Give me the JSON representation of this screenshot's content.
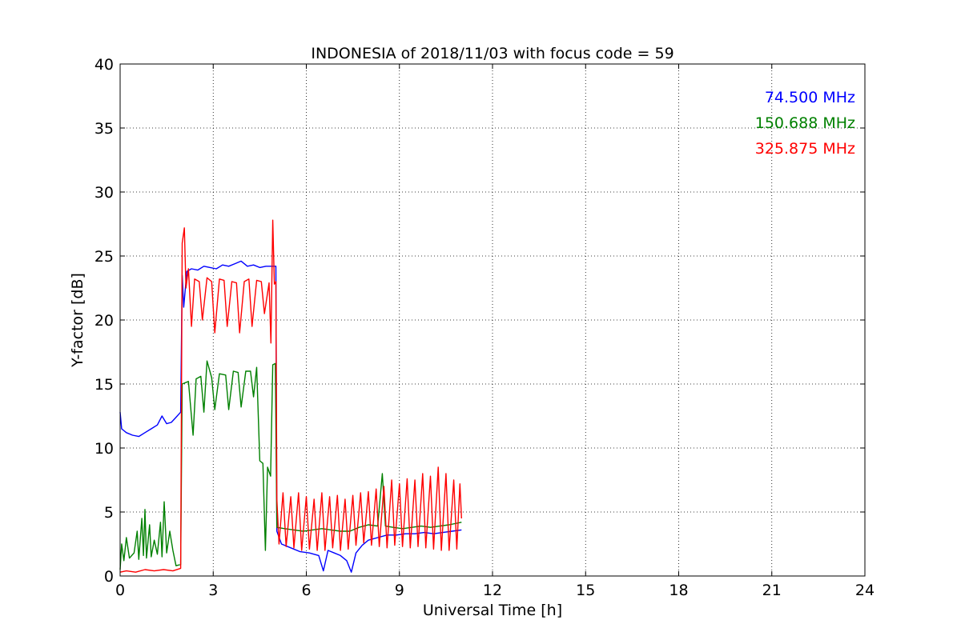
{
  "chart_data": {
    "type": "line",
    "title": "INDONESIA of 2018/11/03 with focus code = 59",
    "xlabel": "Universal Time [h]",
    "ylabel": "Y-factor [dB]",
    "xlim": [
      0,
      24
    ],
    "ylim": [
      0,
      40
    ],
    "xticks": [
      0,
      3,
      6,
      9,
      12,
      15,
      18,
      21,
      24
    ],
    "yticks": [
      0,
      5,
      10,
      15,
      20,
      25,
      30,
      35,
      40
    ],
    "grid": true,
    "legend_position": "top-right",
    "series": [
      {
        "name": "74.500 MHz",
        "color": "#0000ff",
        "points": [
          [
            0.0,
            12.8
          ],
          [
            0.05,
            11.5
          ],
          [
            0.2,
            11.2
          ],
          [
            0.4,
            11.0
          ],
          [
            0.6,
            10.9
          ],
          [
            0.8,
            11.2
          ],
          [
            1.0,
            11.5
          ],
          [
            1.2,
            11.8
          ],
          [
            1.35,
            12.5
          ],
          [
            1.5,
            11.9
          ],
          [
            1.65,
            12.0
          ],
          [
            1.8,
            12.4
          ],
          [
            1.95,
            12.8
          ],
          [
            2.0,
            23.5
          ],
          [
            2.05,
            21.0
          ],
          [
            2.15,
            23.8
          ],
          [
            2.3,
            24.0
          ],
          [
            2.5,
            23.9
          ],
          [
            2.7,
            24.2
          ],
          [
            2.9,
            24.1
          ],
          [
            3.1,
            24.0
          ],
          [
            3.3,
            24.3
          ],
          [
            3.5,
            24.2
          ],
          [
            3.7,
            24.4
          ],
          [
            3.9,
            24.6
          ],
          [
            4.1,
            24.2
          ],
          [
            4.3,
            24.3
          ],
          [
            4.5,
            24.1
          ],
          [
            4.7,
            24.2
          ],
          [
            4.9,
            24.2
          ],
          [
            5.02,
            24.2
          ],
          [
            5.05,
            3.5
          ],
          [
            5.2,
            2.5
          ],
          [
            5.5,
            2.2
          ],
          [
            5.8,
            1.9
          ],
          [
            6.1,
            1.8
          ],
          [
            6.4,
            1.6
          ],
          [
            6.55,
            0.4
          ],
          [
            6.7,
            2.0
          ],
          [
            6.9,
            1.8
          ],
          [
            7.1,
            1.6
          ],
          [
            7.3,
            1.2
          ],
          [
            7.45,
            0.3
          ],
          [
            7.6,
            1.8
          ],
          [
            7.8,
            2.4
          ],
          [
            8.0,
            2.8
          ],
          [
            8.3,
            3.0
          ],
          [
            8.6,
            3.2
          ],
          [
            8.9,
            3.2
          ],
          [
            9.2,
            3.3
          ],
          [
            9.5,
            3.3
          ],
          [
            9.8,
            3.4
          ],
          [
            10.1,
            3.3
          ],
          [
            10.4,
            3.4
          ],
          [
            10.7,
            3.5
          ],
          [
            11.0,
            3.6
          ]
        ]
      },
      {
        "name": "150.688 MHz",
        "color": "#008000",
        "points": [
          [
            0.0,
            0.5
          ],
          [
            0.05,
            2.5
          ],
          [
            0.12,
            1.2
          ],
          [
            0.2,
            3.0
          ],
          [
            0.3,
            1.4
          ],
          [
            0.45,
            1.8
          ],
          [
            0.55,
            3.5
          ],
          [
            0.6,
            1.3
          ],
          [
            0.7,
            4.5
          ],
          [
            0.75,
            1.6
          ],
          [
            0.8,
            5.2
          ],
          [
            0.85,
            1.4
          ],
          [
            0.95,
            4.0
          ],
          [
            1.0,
            1.5
          ],
          [
            1.1,
            2.8
          ],
          [
            1.2,
            1.7
          ],
          [
            1.3,
            4.2
          ],
          [
            1.35,
            1.5
          ],
          [
            1.42,
            5.8
          ],
          [
            1.5,
            1.8
          ],
          [
            1.6,
            3.5
          ],
          [
            1.7,
            2.0
          ],
          [
            1.8,
            0.8
          ],
          [
            1.95,
            0.9
          ],
          [
            2.0,
            15.0
          ],
          [
            2.2,
            15.2
          ],
          [
            2.35,
            11.0
          ],
          [
            2.45,
            15.4
          ],
          [
            2.6,
            15.6
          ],
          [
            2.7,
            12.8
          ],
          [
            2.8,
            16.8
          ],
          [
            2.95,
            15.5
          ],
          [
            3.05,
            13.0
          ],
          [
            3.2,
            15.8
          ],
          [
            3.4,
            15.7
          ],
          [
            3.5,
            13.0
          ],
          [
            3.65,
            16.0
          ],
          [
            3.8,
            15.9
          ],
          [
            3.9,
            13.2
          ],
          [
            4.05,
            16.0
          ],
          [
            4.2,
            16.0
          ],
          [
            4.3,
            14.0
          ],
          [
            4.4,
            16.3
          ],
          [
            4.5,
            9.0
          ],
          [
            4.6,
            8.8
          ],
          [
            4.68,
            2.0
          ],
          [
            4.75,
            8.5
          ],
          [
            4.85,
            7.8
          ],
          [
            4.92,
            16.5
          ],
          [
            5.0,
            16.6
          ],
          [
            5.05,
            3.8
          ],
          [
            5.3,
            3.7
          ],
          [
            5.6,
            3.6
          ],
          [
            5.9,
            3.5
          ],
          [
            6.2,
            3.6
          ],
          [
            6.5,
            3.7
          ],
          [
            6.8,
            3.6
          ],
          [
            7.1,
            3.5
          ],
          [
            7.4,
            3.5
          ],
          [
            7.7,
            3.8
          ],
          [
            8.0,
            4.0
          ],
          [
            8.3,
            3.9
          ],
          [
            8.45,
            8.0
          ],
          [
            8.55,
            3.9
          ],
          [
            8.8,
            3.8
          ],
          [
            9.1,
            3.7
          ],
          [
            9.4,
            3.8
          ],
          [
            9.7,
            3.9
          ],
          [
            10.0,
            3.8
          ],
          [
            10.3,
            3.9
          ],
          [
            10.6,
            4.0
          ],
          [
            11.0,
            4.2
          ]
        ]
      },
      {
        "name": "325.875 MHz",
        "color": "#ff0000",
        "points": [
          [
            0.0,
            0.3
          ],
          [
            0.2,
            0.4
          ],
          [
            0.5,
            0.3
          ],
          [
            0.8,
            0.5
          ],
          [
            1.1,
            0.4
          ],
          [
            1.4,
            0.5
          ],
          [
            1.7,
            0.4
          ],
          [
            1.95,
            0.6
          ],
          [
            2.0,
            26.0
          ],
          [
            2.07,
            27.2
          ],
          [
            2.12,
            22.5
          ],
          [
            2.2,
            24.0
          ],
          [
            2.3,
            19.5
          ],
          [
            2.4,
            23.2
          ],
          [
            2.55,
            23.0
          ],
          [
            2.65,
            20.0
          ],
          [
            2.8,
            23.3
          ],
          [
            2.95,
            23.0
          ],
          [
            3.05,
            19.0
          ],
          [
            3.2,
            23.2
          ],
          [
            3.35,
            23.1
          ],
          [
            3.45,
            19.5
          ],
          [
            3.6,
            23.0
          ],
          [
            3.75,
            22.9
          ],
          [
            3.85,
            19.0
          ],
          [
            4.0,
            23.0
          ],
          [
            4.15,
            23.2
          ],
          [
            4.25,
            19.5
          ],
          [
            4.4,
            23.1
          ],
          [
            4.55,
            23.0
          ],
          [
            4.65,
            20.5
          ],
          [
            4.8,
            22.9
          ],
          [
            4.86,
            18.2
          ],
          [
            4.92,
            27.8
          ],
          [
            4.97,
            22.8
          ],
          [
            5.02,
            23.0
          ],
          [
            5.05,
            6.0
          ],
          [
            5.12,
            2.5
          ],
          [
            5.25,
            6.5
          ],
          [
            5.35,
            2.3
          ],
          [
            5.5,
            6.2
          ],
          [
            5.6,
            2.2
          ],
          [
            5.75,
            6.5
          ],
          [
            5.85,
            2.0
          ],
          [
            6.0,
            6.2
          ],
          [
            6.1,
            2.1
          ],
          [
            6.25,
            6.0
          ],
          [
            6.35,
            2.0
          ],
          [
            6.5,
            6.5
          ],
          [
            6.6,
            2.0
          ],
          [
            6.75,
            6.2
          ],
          [
            6.85,
            2.2
          ],
          [
            7.0,
            6.3
          ],
          [
            7.1,
            2.0
          ],
          [
            7.25,
            6.0
          ],
          [
            7.35,
            2.1
          ],
          [
            7.5,
            6.3
          ],
          [
            7.6,
            2.4
          ],
          [
            7.75,
            6.5
          ],
          [
            7.85,
            2.6
          ],
          [
            8.0,
            6.6
          ],
          [
            8.1,
            2.4
          ],
          [
            8.25,
            6.8
          ],
          [
            8.35,
            2.3
          ],
          [
            8.5,
            7.0
          ],
          [
            8.6,
            2.2
          ],
          [
            8.75,
            7.5
          ],
          [
            8.85,
            2.4
          ],
          [
            9.0,
            7.2
          ],
          [
            9.1,
            2.3
          ],
          [
            9.25,
            7.6
          ],
          [
            9.35,
            2.2
          ],
          [
            9.5,
            7.5
          ],
          [
            9.6,
            2.3
          ],
          [
            9.75,
            8.0
          ],
          [
            9.85,
            2.2
          ],
          [
            10.0,
            7.8
          ],
          [
            10.1,
            2.1
          ],
          [
            10.25,
            8.5
          ],
          [
            10.35,
            2.0
          ],
          [
            10.5,
            8.0
          ],
          [
            10.6,
            2.0
          ],
          [
            10.75,
            7.5
          ],
          [
            10.85,
            2.1
          ],
          [
            10.95,
            7.2
          ],
          [
            11.0,
            4.5
          ]
        ]
      }
    ]
  }
}
